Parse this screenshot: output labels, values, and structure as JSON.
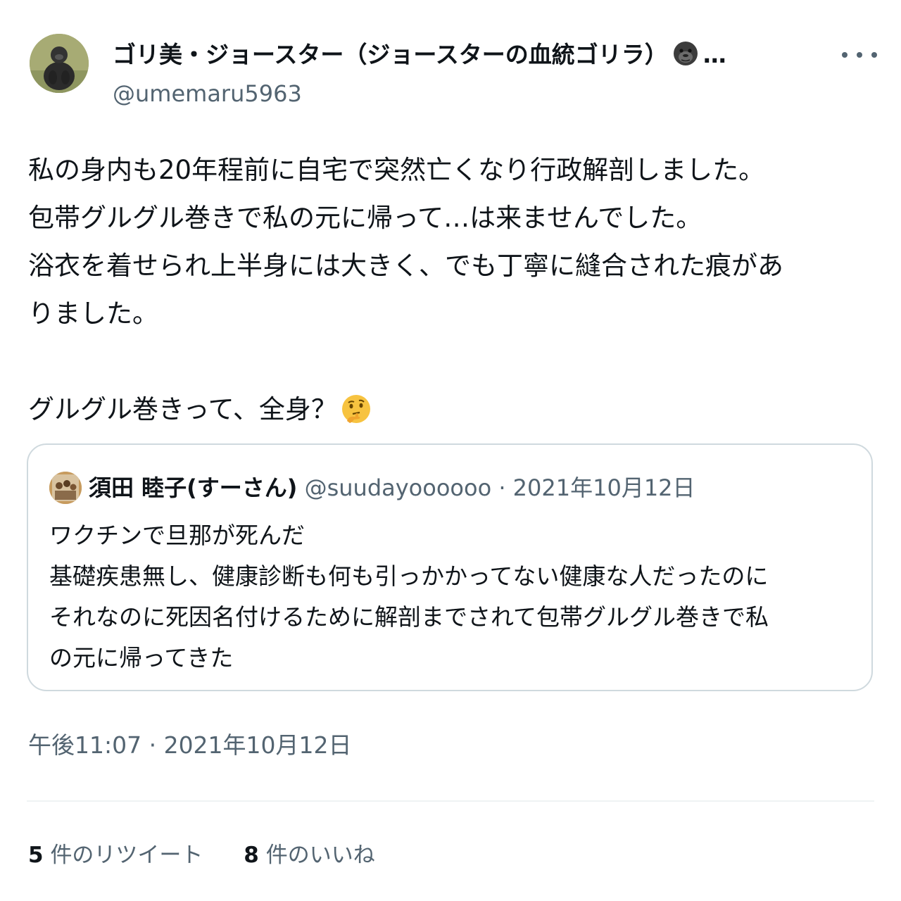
{
  "author": {
    "display_name": "ゴリ美・ジョースター（ジョースターの血統ゴリラ）",
    "name_truncation": "…",
    "emoji_icon": "gorilla-emoji",
    "username": "@umemaru5963",
    "avatar_icon": "gorilla-photo-avatar"
  },
  "tweet": {
    "lines": [
      "私の身内も20年程前に自宅で突然亡くなり行政解剖しました。",
      "包帯グルグル巻きで私の元に帰って…は来ませんでした。",
      "浴衣を着せられ上半身には大きく、でも丁寧に縫合された痕があ",
      "りました。",
      "",
      "グルグル巻きって、全身？"
    ],
    "trailing_emoji": "thinking-face-emoji",
    "timestamp": "午後11:07 · 2021年10月12日"
  },
  "quote": {
    "name": "須田 睦子(すーさん)",
    "handle": "@suudayoooooo",
    "separator": "·",
    "date": "2021年10月12日",
    "lines": [
      "ワクチンで旦那が死んだ",
      "基礎疾患無し、健康診断も何も引っかかってない健康な人だったのに",
      "それなのに死因名付けるために解剖までされて包帯グルグル巻きで私",
      "の元に帰ってきた"
    ]
  },
  "stats": {
    "retweets_count": "5",
    "retweets_label": "件のリツイート",
    "likes_count": "8",
    "likes_label": "件のいいね"
  },
  "colors": {
    "text": "#0f1419",
    "secondary": "#536471",
    "border": "#cfd9de"
  }
}
